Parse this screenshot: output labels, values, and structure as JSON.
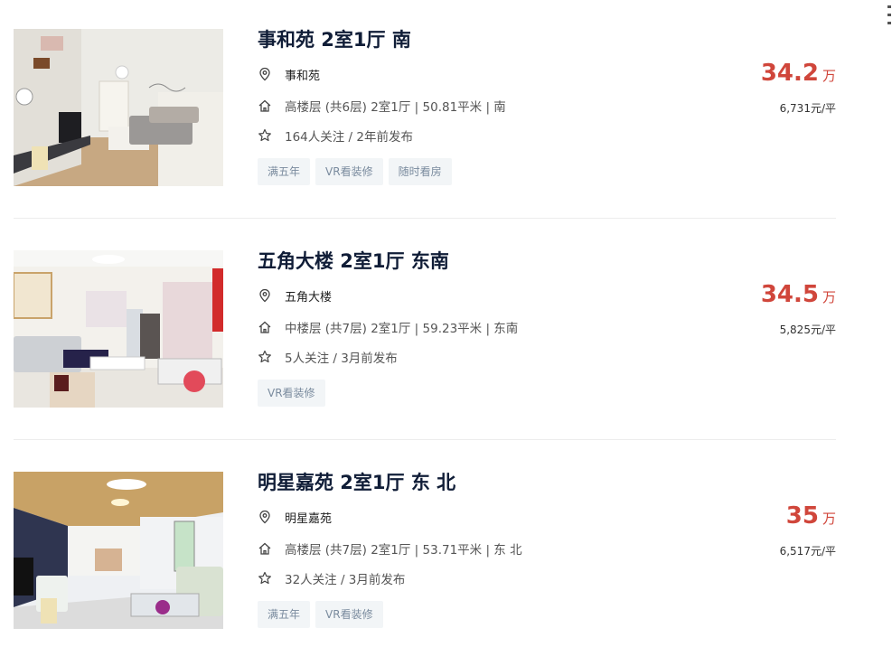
{
  "colors": {
    "price": "#d0463b",
    "title": "#101d37",
    "tag_bg": "#f2f5f7",
    "tag_text": "#7a8b9e"
  },
  "listings": [
    {
      "title": "事和苑 2室1厅 南",
      "community": "事和苑",
      "info": "高楼层 (共6层) 2室1厅 | 50.81平米 | 南",
      "follow": "164人关注 / 2年前发布",
      "tags": [
        "满五年",
        "VR看装修",
        "随时看房"
      ],
      "total_price": "34.2",
      "price_unit": "万",
      "unit_price": "6,731元/平"
    },
    {
      "title": "五角大楼 2室1厅 东南",
      "community": "五角大楼",
      "info": "中楼层 (共7层) 2室1厅 | 59.23平米 | 东南",
      "follow": "5人关注 / 3月前发布",
      "tags": [
        "VR看装修"
      ],
      "total_price": "34.5",
      "price_unit": "万",
      "unit_price": "5,825元/平"
    },
    {
      "title": "明星嘉苑 2室1厅 东 北",
      "community": "明星嘉苑",
      "info": "高楼层 (共7层) 2室1厅 | 53.71平米 | 东 北",
      "follow": "32人关注 / 3月前发布",
      "tags": [
        "满五年",
        "VR看装修"
      ],
      "total_price": "35",
      "price_unit": "万",
      "unit_price": "6,517元/平"
    }
  ]
}
